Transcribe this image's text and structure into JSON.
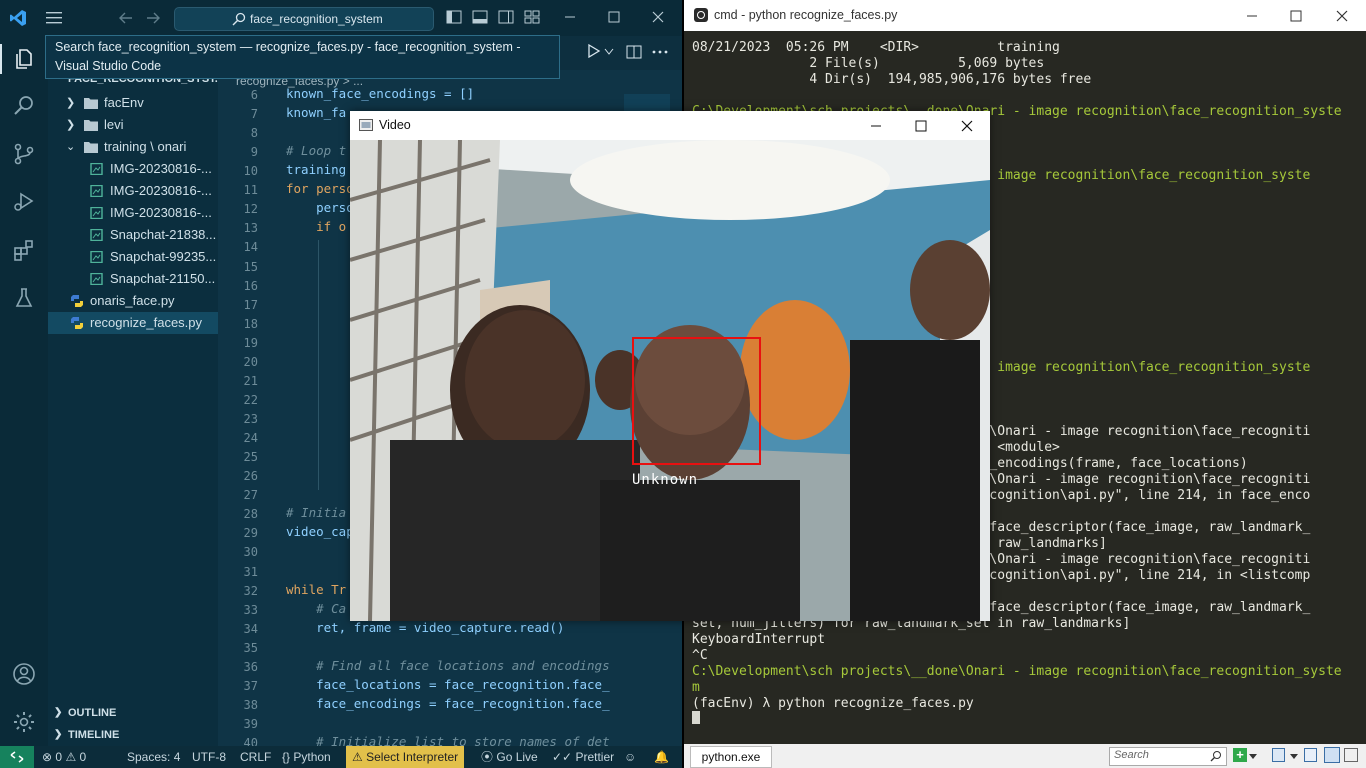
{
  "vscode": {
    "search_text": "face_recognition_system",
    "tooltip": "Search face_recognition_system — recognize_faces.py - face_recognition_system - Visual Studio Code",
    "explorer_header": "FACE_RECOGNITION_SYST...",
    "breadcrumb": "recognize_faces.py > ...",
    "tree": [
      {
        "label": "facEnv",
        "kind": "folder",
        "state": "closed",
        "indent": 1
      },
      {
        "label": "levi",
        "kind": "folder",
        "state": "closed",
        "indent": 1
      },
      {
        "label": "training \\ onari",
        "kind": "folder",
        "state": "open",
        "indent": 1
      },
      {
        "label": "IMG-20230816-...",
        "kind": "image",
        "indent": 2
      },
      {
        "label": "IMG-20230816-...",
        "kind": "image",
        "indent": 2
      },
      {
        "label": "IMG-20230816-...",
        "kind": "image",
        "indent": 2
      },
      {
        "label": "Snapchat-21838...",
        "kind": "image",
        "indent": 2
      },
      {
        "label": "Snapchat-99235...",
        "kind": "image",
        "indent": 2
      },
      {
        "label": "Snapchat-21150...",
        "kind": "image",
        "indent": 2
      },
      {
        "label": "onaris_face.py",
        "kind": "python",
        "indent": 1
      },
      {
        "label": "recognize_faces.py",
        "kind": "python",
        "indent": 1,
        "selected": true
      }
    ],
    "sections": [
      "OUTLINE",
      "TIMELINE"
    ],
    "line_numbers": [
      "6",
      "7",
      "8",
      "9",
      "10",
      "11",
      "12",
      "13",
      "14",
      "15",
      "16",
      "17",
      "18",
      "19",
      "20",
      "21",
      "22",
      "23",
      "24",
      "25",
      "26",
      "27",
      "28",
      "29",
      "30",
      "31",
      "32",
      "33",
      "34",
      "35",
      "36",
      "37",
      "38",
      "39",
      "40"
    ],
    "code_lines": [
      {
        "n": 6,
        "text": "known_face_encodings = []",
        "kind": "plain"
      },
      {
        "n": 7,
        "text": "known_fa",
        "kind": "plain"
      },
      {
        "n": 8,
        "text": "",
        "kind": "plain"
      },
      {
        "n": 9,
        "text": "# Loop t",
        "kind": "comment"
      },
      {
        "n": 10,
        "text": "training",
        "kind": "plain"
      },
      {
        "n": 11,
        "text": "for perso",
        "kind": "keyword"
      },
      {
        "n": 12,
        "text": "    perso",
        "kind": "plain"
      },
      {
        "n": 13,
        "text": "    if o",
        "kind": "keyword"
      },
      {
        "n": 27,
        "text": "",
        "kind": "plain"
      },
      {
        "n": 28,
        "text": "# Initia",
        "kind": "comment"
      },
      {
        "n": 29,
        "text": "video_cap",
        "kind": "plain"
      },
      {
        "n": 31,
        "text": "",
        "kind": "plain"
      },
      {
        "n": 32,
        "text": "while Tr",
        "kind": "keyword"
      },
      {
        "n": 33,
        "text": "    # Ca",
        "kind": "comment"
      },
      {
        "n": 34,
        "text": "    ret, frame = video_capture.read()",
        "kind": "plain"
      },
      {
        "n": 36,
        "text": "    # Find all face locations and encodings",
        "kind": "comment"
      },
      {
        "n": 37,
        "text": "    face_locations = face_recognition.face_",
        "kind": "call"
      },
      {
        "n": 38,
        "text": "    face_encodings = face_recognition.face_",
        "kind": "call"
      },
      {
        "n": 40,
        "text": "    # Initialize list to store names of det",
        "kind": "comment"
      }
    ],
    "status": {
      "problems": "0",
      "warnings": "0",
      "spaces": "Spaces: 4",
      "encoding": "UTF-8",
      "eol": "CRLF",
      "language": "Python",
      "interpreter": "Select Interpreter",
      "golive": "Go Live",
      "prettier": "Prettier"
    }
  },
  "cmd": {
    "title": "cmd - python  recognize_faces.py",
    "lines": [
      {
        "text": "08/21/2023  05:26 PM    <DIR>          training",
        "color": "white"
      },
      {
        "text": "               2 File(s)          5,069 bytes",
        "color": "white"
      },
      {
        "text": "               4 Dir(s)  194,985,906,176 bytes free",
        "color": "white"
      },
      {
        "text": "",
        "color": "white"
      },
      {
        "text": "C:\\Development\\sch projects\\__done\\Onari - image recognition\\face_recognition_syste",
        "color": "green"
      },
      {
        "text": "",
        "color": "white"
      },
      {
        "text": "",
        "color": "white"
      },
      {
        "text": "",
        "color": "white"
      },
      {
        "text": "                                 ari - image recognition\\face_recognition_syste",
        "color": "green"
      },
      {
        "text": "",
        "color": "white"
      },
      {
        "text": "",
        "color": "white"
      },
      {
        "text": "",
        "color": "white"
      },
      {
        "text": "",
        "color": "white"
      },
      {
        "text": "",
        "color": "white"
      },
      {
        "text": "",
        "color": "white"
      },
      {
        "text": "",
        "color": "white"
      },
      {
        "text": "",
        "color": "white"
      },
      {
        "text": "",
        "color": "white"
      },
      {
        "text": "",
        "color": "white"
      },
      {
        "text": "",
        "color": "white"
      },
      {
        "text": "                                 ari - image recognition\\face_recognition_syste",
        "color": "green"
      },
      {
        "text": "",
        "color": "white"
      },
      {
        "text": "",
        "color": "white"
      },
      {
        "text": "",
        "color": "white"
      },
      {
        "text": "                                 _done\\Onari - image recognition\\face_recogniti",
        "color": "white"
      },
      {
        "text": "                                 3, in <module>",
        "color": "white"
      },
      {
        "text": "                                 .face_encodings(frame, face_locations)",
        "color": "white"
      },
      {
        "text": "                                 _done\\Onari - image recognition\\face_recogniti",
        "color": "white"
      },
      {
        "text": "                                 ce_recognition\\api.py\", line 214, in face_enco",
        "color": "white"
      },
      {
        "text": "",
        "color": "white"
      },
      {
        "text": "                                 pute_face_descriptor(face_image, raw_landmark_",
        "color": "white"
      },
      {
        "text": "                                 et in raw_landmarks]",
        "color": "white"
      },
      {
        "text": "                                 _done\\Onari - image recognition\\face_recogniti",
        "color": "white"
      },
      {
        "text": "                                 ce_recognition\\api.py\", line 214, in <listcomp",
        "color": "white"
      },
      {
        "text": "",
        "color": "white"
      },
      {
        "text": "                                 pute_face_descriptor(face_image, raw_landmark_",
        "color": "white"
      },
      {
        "text": "set, num_jitters) for raw_landmark_set in raw_landmarks]",
        "color": "white"
      },
      {
        "text": "KeyboardInterrupt",
        "color": "white"
      },
      {
        "text": "^C",
        "color": "white"
      },
      {
        "text": "C:\\Development\\sch projects\\__done\\Onari - image recognition\\face_recognition_syste",
        "color": "green"
      },
      {
        "text": "m",
        "color": "green"
      },
      {
        "text": "(facEnv) λ python recognize_faces.py",
        "color": "white"
      }
    ],
    "tab_label": "python.exe",
    "search_placeholder": "Search"
  },
  "video": {
    "title": "Video",
    "face_label": "Unknown"
  },
  "colors": {
    "vscode_bg": "#0d2f3f",
    "accent_green": "#a6c93a",
    "face_box": "#e81010",
    "interpreter_warning": "#e2c04a",
    "remote_indicator": "#16825d"
  }
}
